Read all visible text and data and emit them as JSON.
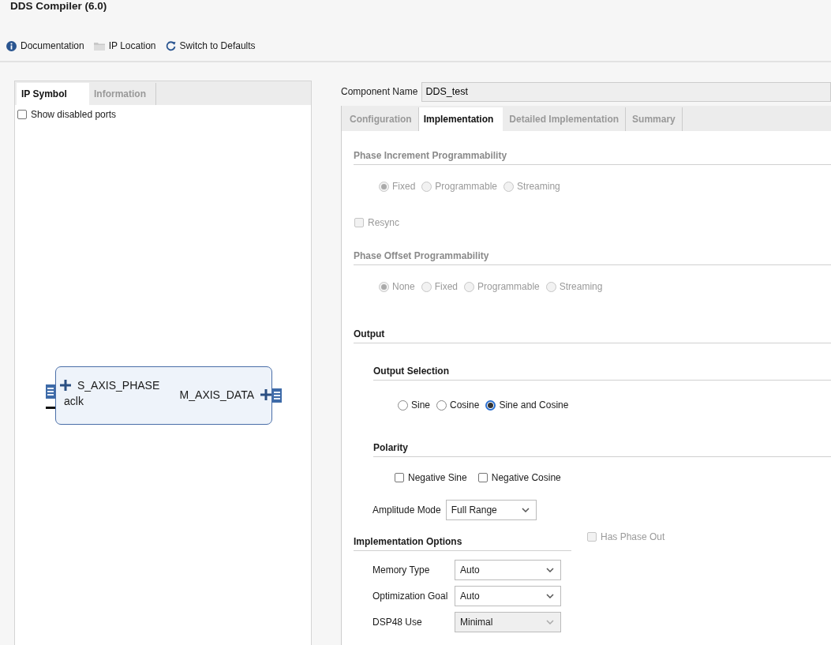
{
  "window": {
    "title": "DDS Compiler (6.0)"
  },
  "toolbar": [
    {
      "kind": "info",
      "label": "Documentation"
    },
    {
      "kind": "folder",
      "label": "IP Location"
    },
    {
      "kind": "refresh",
      "label": "Switch to Defaults"
    }
  ],
  "left_tabs": [
    {
      "label": "IP Symbol",
      "selected": true
    },
    {
      "label": "Information",
      "selected": false
    }
  ],
  "show_disabled_ports": {
    "label": "Show disabled ports",
    "checked": false
  },
  "symbol": {
    "inputs": [
      {
        "kind": "bus",
        "label": "S_AXIS_PHASE"
      },
      {
        "kind": "wire",
        "label": "aclk"
      }
    ],
    "outputs": [
      {
        "kind": "bus",
        "label": "M_AXIS_DATA"
      }
    ]
  },
  "component_name": {
    "label": "Component Name",
    "value": "DDS_test"
  },
  "tabs": [
    {
      "label": "Configuration",
      "selected": false
    },
    {
      "label": "Implementation",
      "selected": true
    },
    {
      "label": "Detailed Implementation",
      "selected": false
    },
    {
      "label": "Summary",
      "selected": false
    }
  ],
  "phase_increment": {
    "title": "Phase Increment Programmability",
    "disabled": true,
    "options": [
      {
        "label": "Fixed",
        "selected": true
      },
      {
        "label": "Programmable",
        "selected": false
      },
      {
        "label": "Streaming",
        "selected": false
      }
    ]
  },
  "resync": {
    "label": "Resync",
    "checked": false,
    "disabled": true
  },
  "phase_offset": {
    "title": "Phase Offset Programmability",
    "disabled": true,
    "options": [
      {
        "label": "None",
        "selected": true
      },
      {
        "label": "Fixed",
        "selected": false
      },
      {
        "label": "Programmable",
        "selected": false
      },
      {
        "label": "Streaming",
        "selected": false
      }
    ]
  },
  "output": {
    "title": "Output",
    "selection": {
      "title": "Output Selection",
      "disabled": false,
      "options": [
        {
          "label": "Sine",
          "selected": false
        },
        {
          "label": "Cosine",
          "selected": false
        },
        {
          "label": "Sine and Cosine",
          "selected": true
        }
      ]
    },
    "polarity": {
      "title": "Polarity",
      "options": [
        {
          "label": "Negative Sine",
          "checked": false
        },
        {
          "label": "Negative Cosine",
          "checked": false
        }
      ]
    },
    "amplitude_mode": {
      "label": "Amplitude Mode",
      "value": "Full Range"
    }
  },
  "implementation_options": {
    "title": "Implementation Options",
    "fields": [
      {
        "label": "Memory Type",
        "value": "Auto",
        "disabled": false
      },
      {
        "label": "Optimization Goal",
        "value": "Auto",
        "disabled": false
      },
      {
        "label": "DSP48 Use",
        "value": "Minimal",
        "disabled": true
      }
    ]
  },
  "has_phase_out": {
    "label": "Has Phase Out",
    "checked": false,
    "disabled": true
  }
}
